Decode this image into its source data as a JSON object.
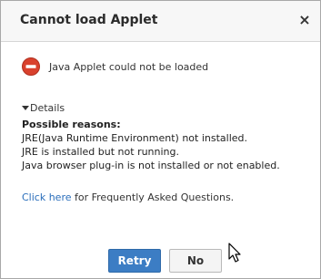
{
  "dialog": {
    "title": "Cannot load Applet",
    "close_glyph": "×",
    "error_message": "Java Applet could not be loaded",
    "error_icon": "error-stop-icon",
    "error_color": "#d9412d"
  },
  "details": {
    "label": "Details",
    "expanded": true,
    "heading": "Possible reasons:",
    "reasons": [
      "JRE(Java Runtime Environment) not installed.",
      "JRE is installed but not running.",
      "Java browser plug-in is not installed or not enabled."
    ]
  },
  "faq": {
    "link_text": "Click here",
    "rest_text": " for Frequently Asked Questions."
  },
  "buttons": {
    "retry_label": "Retry",
    "no_label": "No"
  },
  "colors": {
    "primary_button": "#3c7dc4",
    "link": "#2a6ebb"
  }
}
